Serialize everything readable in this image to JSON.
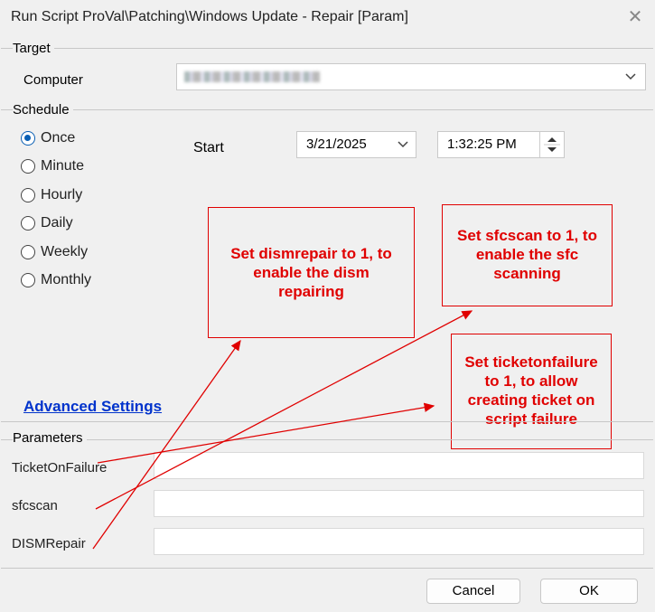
{
  "window": {
    "title": "Run Script ProVal\\Patching\\Windows Update - Repair [Param]",
    "close_glyph": "✕"
  },
  "target": {
    "section_label": "Target",
    "computer_label": "Computer"
  },
  "schedule": {
    "section_label": "Schedule",
    "options": [
      "Once",
      "Minute",
      "Hourly",
      "Daily",
      "Weekly",
      "Monthly"
    ],
    "selected": "Once",
    "start_label": "Start",
    "start_date": "3/21/2025",
    "start_time": "1:32:25 PM"
  },
  "annotations": {
    "dism": [
      "Set dismrepair to 1, to",
      "enable the dism",
      "repairing"
    ],
    "sfc": [
      "Set sfcscan to 1, to",
      "enable the sfc",
      "scanning"
    ],
    "ticket": [
      "Set ticketonfailure",
      "to 1, to allow",
      "creating ticket on",
      "script failure"
    ]
  },
  "advanced_settings_link": "Advanced Settings",
  "parameters": {
    "section_label": "Parameters",
    "fields": [
      {
        "label": "TicketOnFailure",
        "value": ""
      },
      {
        "label": "sfcscan",
        "value": ""
      },
      {
        "label": "DISMRepair",
        "value": ""
      }
    ]
  },
  "buttons": {
    "cancel": "Cancel",
    "ok": "OK"
  },
  "colors": {
    "annotation_red": "#e00000",
    "radio_selected": "#0a5fb4",
    "link_blue": "#0033cc"
  },
  "icons": {
    "combo_dropdown": "chevron-down-icon",
    "date_dropdown": "chevron-down-icon",
    "time_spinner": "spinner-icon",
    "close": "close-icon"
  }
}
